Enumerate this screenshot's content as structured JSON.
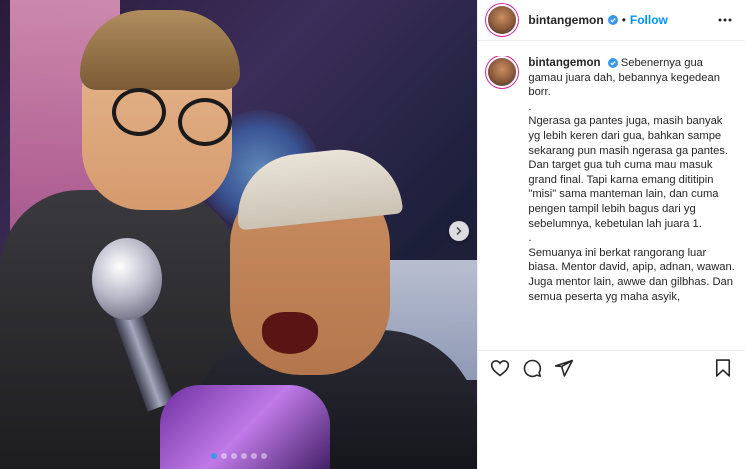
{
  "post": {
    "username": "bintangemon",
    "separator": "•",
    "follow_label": "Follow",
    "caption_paragraphs": [
      "Sebenernya gua gamau juara dah, bebannya kegedean borr.",
      ".",
      "Ngerasa ga pantes juga, masih banyak yg lebih keren dari gua, bahkan sampe sekarang pun masih ngerasa ga pantes. Dan target gua tuh cuma mau masuk grand final. Tapi karna emang dititipin \"misi\" sama manteman lain, dan cuma pengen tampil lebih bagus dari yg sebelumnya, kebetulan lah juara 1.",
      ".",
      "Semuanya ini berkat rangorang luar biasa. Mentor david, apip, adnan, wawan. Juga mentor lain, awwe dan gilbhas. Dan semua peserta yg maha asyik,"
    ]
  },
  "carousel": {
    "count": 6,
    "active_index": 0
  },
  "icons": {
    "header_more": "more-dots-icon",
    "verified": "verified-badge-icon",
    "like": "heart-icon",
    "comment": "comment-bubble-icon",
    "share": "share-paper-plane-icon",
    "save": "bookmark-icon",
    "next": "chevron-right-icon"
  },
  "colors": {
    "follow": "#0095f6",
    "verified": "#3897f0",
    "text": "#262626"
  }
}
